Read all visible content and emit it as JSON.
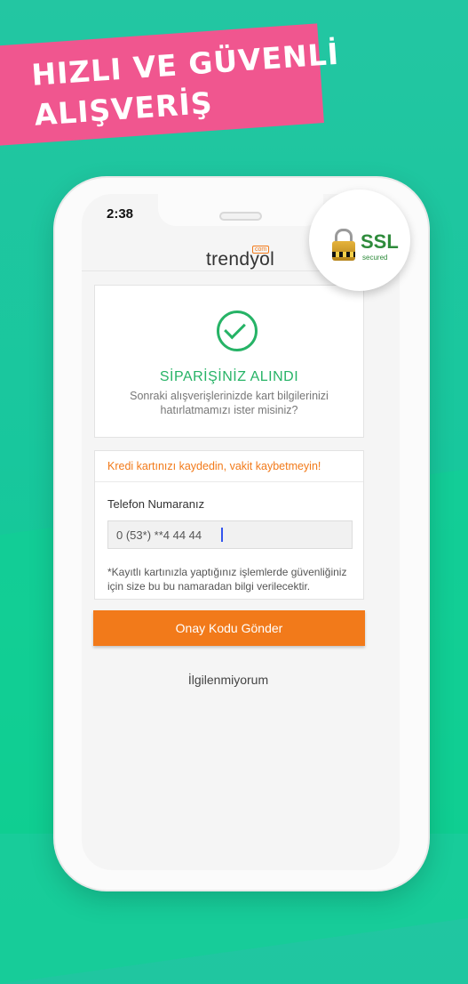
{
  "promo": {
    "line1": "HIZLI VE GÜVENLİ",
    "line2": "ALIŞVERİŞ"
  },
  "status_bar": {
    "time": "2:38"
  },
  "brand": {
    "logo": "trendyol",
    "logo_suffix": "com"
  },
  "order": {
    "title": "SİPARİŞİNİZ ALINDI",
    "subtitle": "Sonraki alışverişlerinizde kart bilgilerinizi hatırlatmamızı ister misiniz?"
  },
  "save_card": {
    "promo": "Kredi kartınızı kaydedin, vakit kaybetmeyin!",
    "phone_label": "Telefon Numaranız",
    "phone_value": "0 (53*) **4 44 44",
    "note": "*Kayıtlı kartınızla yaptığınız işlemlerde güvenliğiniz için size bu bu namaradan bilgi verilecektir."
  },
  "actions": {
    "confirm": "Onay Kodu Gönder",
    "dismiss": "İlgilenmiyorum"
  },
  "ssl_badge": {
    "title": "SSL",
    "subtitle": "secured",
    "icon": "lock-icon"
  },
  "colors": {
    "accent": "#f27a1a",
    "success": "#26b366",
    "banner": "#f0568f",
    "background": "#18c79d"
  }
}
